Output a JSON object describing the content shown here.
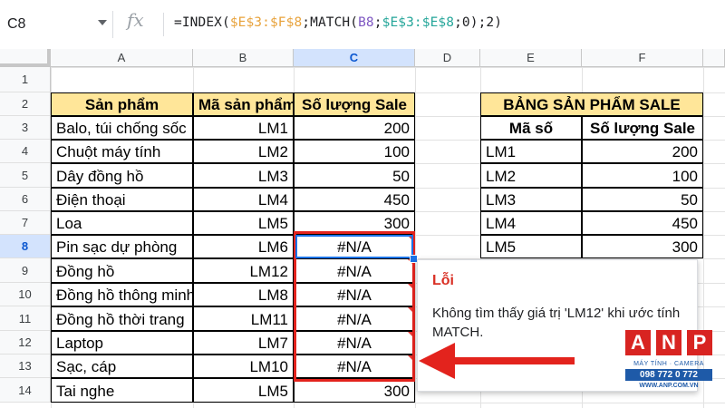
{
  "formula_bar": {
    "cell_ref": "C8",
    "fx": "fx",
    "formula_parts": [
      {
        "t": "=INDEX(",
        "color": "#202124"
      },
      {
        "t": "$E$3:$F$8",
        "color": "#e8a33d"
      },
      {
        "t": ";MATCH(",
        "color": "#202124"
      },
      {
        "t": "B8",
        "color": "#7e57c2"
      },
      {
        "t": ";",
        "color": "#202124"
      },
      {
        "t": "$E$3:$E$8",
        "color": "#26a69a"
      },
      {
        "t": ";0);2)",
        "color": "#202124"
      }
    ]
  },
  "columns": [
    "A",
    "B",
    "C",
    "D",
    "E",
    "F"
  ],
  "rows": [
    "1",
    "2",
    "3",
    "4",
    "5",
    "6",
    "7",
    "8",
    "9",
    "10",
    "11",
    "12",
    "13",
    "14"
  ],
  "main_table": {
    "headers": [
      "Sản phẩm",
      "Mã sản phẩm",
      "Số lượng Sale"
    ],
    "rows": [
      [
        "Balo, túi chống sốc",
        "LM1",
        "200"
      ],
      [
        "Chuột máy tính",
        "LM2",
        "100"
      ],
      [
        "Dây đồng hồ",
        "LM3",
        "50"
      ],
      [
        "Điện thoại",
        "LM4",
        "450"
      ],
      [
        "Loa",
        "LM5",
        "300"
      ],
      [
        "Pin sạc dự phòng",
        "LM6",
        "#N/A"
      ],
      [
        "Đồng hồ",
        "LM12",
        "#N/A"
      ],
      [
        "Đồng hồ thông minh",
        "LM8",
        "#N/A"
      ],
      [
        "Đồng hồ thời trang",
        "LM11",
        "#N/A"
      ],
      [
        "Laptop",
        "LM7",
        "#N/A"
      ],
      [
        "Sạc, cáp",
        "LM10",
        "#N/A"
      ],
      [
        "Tai nghe",
        "LM5",
        "300"
      ]
    ]
  },
  "sale_table": {
    "title": "BẢNG SẢN PHẨM SALE",
    "headers": [
      "Mã số",
      "Số lượng Sale"
    ],
    "rows": [
      [
        "LM1",
        "200"
      ],
      [
        "LM2",
        "100"
      ],
      [
        "LM3",
        "50"
      ],
      [
        "LM4",
        "450"
      ],
      [
        "LM5",
        "300"
      ]
    ]
  },
  "error_tooltip": {
    "title": "Lỗi",
    "message": "Không tìm thấy giá trị 'LM12' khi ước tính MATCH."
  },
  "logo": {
    "letters": [
      "A",
      "N",
      "P"
    ],
    "tagline": "MÁY TÍNH · CAMERA",
    "phone": "098 772 0 772",
    "website": "WWW.ANP.COM.VN"
  },
  "colors": {
    "header_fill": "#ffe699",
    "selection_blue": "#1a73e8",
    "highlight_red": "#e3231d"
  }
}
